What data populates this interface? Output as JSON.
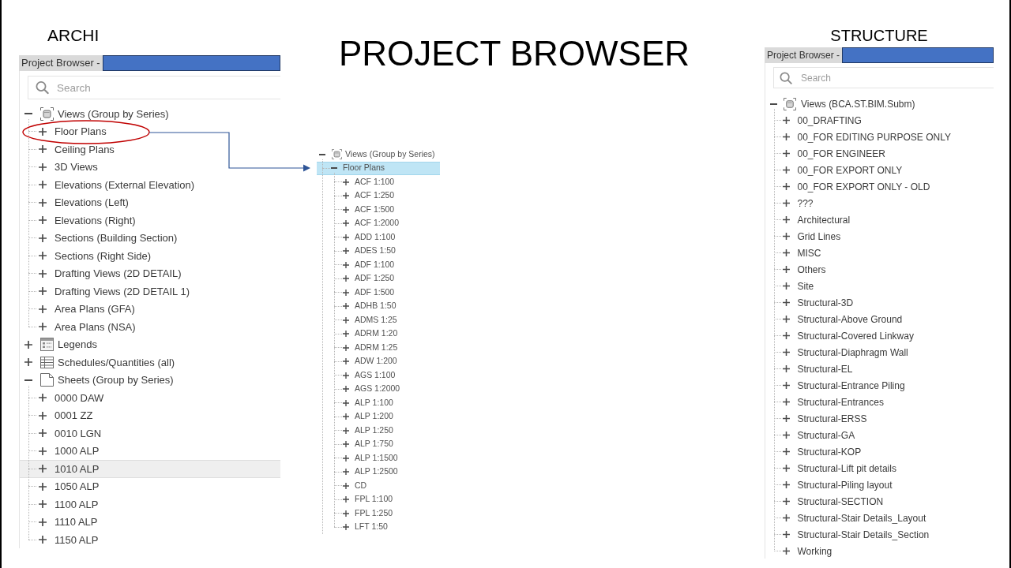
{
  "panels": [
    {
      "label": "ARCHI",
      "header": "Project Browser -",
      "search": {
        "placeholder": "Search"
      },
      "tree": [
        {
          "label": "Views (Group by Series)",
          "kind": "views",
          "expanded": true,
          "selected": false,
          "children": [
            {
              "label": "Floor Plans",
              "expanded": false,
              "selected": false
            },
            {
              "label": "Ceiling Plans",
              "expanded": false,
              "selected": false
            },
            {
              "label": "3D Views",
              "expanded": false,
              "selected": false
            },
            {
              "label": "Elevations (External Elevation)",
              "expanded": false,
              "selected": false
            },
            {
              "label": "Elevations (Left)",
              "expanded": false,
              "selected": false
            },
            {
              "label": "Elevations (Right)",
              "expanded": false,
              "selected": false
            },
            {
              "label": "Sections (Building Section)",
              "expanded": false,
              "selected": false
            },
            {
              "label": "Sections (Right Side)",
              "expanded": false,
              "selected": false
            },
            {
              "label": "Drafting Views (2D DETAIL)",
              "expanded": false,
              "selected": false
            },
            {
              "label": "Drafting Views (2D DETAIL 1)",
              "expanded": false,
              "selected": false
            },
            {
              "label": "Area Plans (GFA)",
              "expanded": false,
              "selected": false
            },
            {
              "label": "Area Plans (NSA)",
              "expanded": false,
              "selected": false
            }
          ]
        },
        {
          "label": "Legends",
          "kind": "legends",
          "expanded": false,
          "selected": false
        },
        {
          "label": "Schedules/Quantities (all)",
          "kind": "schedules",
          "expanded": false,
          "selected": false
        },
        {
          "label": "Sheets (Group by Series)",
          "kind": "sheets",
          "expanded": true,
          "selected": false,
          "children": [
            {
              "label": "0000 DAW",
              "expanded": false,
              "selected": false
            },
            {
              "label": "0001 ZZ",
              "expanded": false,
              "selected": false
            },
            {
              "label": "0010 LGN",
              "expanded": false,
              "selected": false
            },
            {
              "label": "1000 ALP",
              "expanded": false,
              "selected": false
            },
            {
              "label": "1010 ALP",
              "expanded": false,
              "selected": false,
              "hovered": true
            },
            {
              "label": "1050 ALP",
              "expanded": false,
              "selected": false
            },
            {
              "label": "1100 ALP",
              "expanded": false,
              "selected": false
            },
            {
              "label": "1110 ALP",
              "expanded": false,
              "selected": false
            },
            {
              "label": "1150 ALP",
              "expanded": false,
              "selected": false
            }
          ]
        }
      ]
    },
    {
      "label": "STRUCTURE",
      "header": "Project Browser -",
      "search": {
        "placeholder": "Search"
      },
      "tree": [
        {
          "label": "Views (BCA.ST.BIM.Subm)",
          "kind": "views",
          "expanded": true,
          "selected": false,
          "children": [
            {
              "label": "00_DRAFTING",
              "expanded": false,
              "selected": false
            },
            {
              "label": "00_FOR EDITING PURPOSE ONLY",
              "expanded": false,
              "selected": false
            },
            {
              "label": "00_FOR ENGINEER",
              "expanded": false,
              "selected": false
            },
            {
              "label": "00_FOR EXPORT ONLY",
              "expanded": false,
              "selected": false
            },
            {
              "label": "00_FOR EXPORT ONLY - OLD",
              "expanded": false,
              "selected": false
            },
            {
              "label": "???",
              "expanded": false,
              "selected": false
            },
            {
              "label": "Architectural",
              "expanded": false,
              "selected": false
            },
            {
              "label": "Grid Lines",
              "expanded": false,
              "selected": false
            },
            {
              "label": "MISC",
              "expanded": false,
              "selected": false
            },
            {
              "label": "Others",
              "expanded": false,
              "selected": false
            },
            {
              "label": "Site",
              "expanded": false,
              "selected": false
            },
            {
              "label": "Structural-3D",
              "expanded": false,
              "selected": false
            },
            {
              "label": "Structural-Above Ground",
              "expanded": false,
              "selected": false
            },
            {
              "label": "Structural-Covered Linkway",
              "expanded": false,
              "selected": false
            },
            {
              "label": "Structural-Diaphragm Wall",
              "expanded": false,
              "selected": false
            },
            {
              "label": "Structural-EL",
              "expanded": false,
              "selected": false
            },
            {
              "label": "Structural-Entrance Piling",
              "expanded": false,
              "selected": false
            },
            {
              "label": "Structural-Entrances",
              "expanded": false,
              "selected": false
            },
            {
              "label": "Structural-ERSS",
              "expanded": false,
              "selected": false
            },
            {
              "label": "Structural-GA",
              "expanded": false,
              "selected": false
            },
            {
              "label": "Structural-KOP",
              "expanded": false,
              "selected": false
            },
            {
              "label": "Structural-Lift pit details",
              "expanded": false,
              "selected": false
            },
            {
              "label": "Structural-Piling layout",
              "expanded": false,
              "selected": false
            },
            {
              "label": "Structural-SECTION",
              "expanded": false,
              "selected": false
            },
            {
              "label": "Structural-Stair Details_Layout",
              "expanded": false,
              "selected": false
            },
            {
              "label": "Structural-Stair Details_Section",
              "expanded": false,
              "selected": false
            },
            {
              "label": "Working",
              "expanded": false,
              "selected": false
            }
          ]
        }
      ]
    }
  ],
  "title": "PROJECT BROWSER",
  "zoom_view": {
    "tree": [
      {
        "label": "Views (Group by Series)",
        "kind": "views",
        "expanded": true,
        "selected": false,
        "children": [
          {
            "label": "Floor Plans",
            "expanded": true,
            "selected": true,
            "children": [
              {
                "label": "ACF 1:100",
                "expanded": false,
                "selected": false
              },
              {
                "label": "ACF 1:250",
                "expanded": false,
                "selected": false
              },
              {
                "label": "ACF 1:500",
                "expanded": false,
                "selected": false
              },
              {
                "label": "ACF 1:2000",
                "expanded": false,
                "selected": false
              },
              {
                "label": "ADD 1:100",
                "expanded": false,
                "selected": false
              },
              {
                "label": "ADES 1:50",
                "expanded": false,
                "selected": false
              },
              {
                "label": "ADF 1:100",
                "expanded": false,
                "selected": false
              },
              {
                "label": "ADF 1:250",
                "expanded": false,
                "selected": false
              },
              {
                "label": "ADF 1:500",
                "expanded": false,
                "selected": false
              },
              {
                "label": "ADHB 1:50",
                "expanded": false,
                "selected": false
              },
              {
                "label": "ADMS 1:25",
                "expanded": false,
                "selected": false
              },
              {
                "label": "ADRM 1:20",
                "expanded": false,
                "selected": false
              },
              {
                "label": "ADRM 1:25",
                "expanded": false,
                "selected": false
              },
              {
                "label": "ADW 1:200",
                "expanded": false,
                "selected": false
              },
              {
                "label": "AGS 1:100",
                "expanded": false,
                "selected": false
              },
              {
                "label": "AGS 1:2000",
                "expanded": false,
                "selected": false
              },
              {
                "label": "ALP 1:100",
                "expanded": false,
                "selected": false
              },
              {
                "label": "ALP 1:200",
                "expanded": false,
                "selected": false
              },
              {
                "label": "ALP 1:250",
                "expanded": false,
                "selected": false
              },
              {
                "label": "ALP 1:750",
                "expanded": false,
                "selected": false
              },
              {
                "label": "ALP 1:1500",
                "expanded": false,
                "selected": false
              },
              {
                "label": "ALP 1:2500",
                "expanded": false,
                "selected": false
              },
              {
                "label": "CD",
                "expanded": false,
                "selected": false
              },
              {
                "label": "FPL 1:100",
                "expanded": false,
                "selected": false
              },
              {
                "label": "FPL 1:250",
                "expanded": false,
                "selected": false
              },
              {
                "label": "LFT 1:50",
                "expanded": false,
                "selected": false
              }
            ]
          }
        ]
      }
    ]
  }
}
